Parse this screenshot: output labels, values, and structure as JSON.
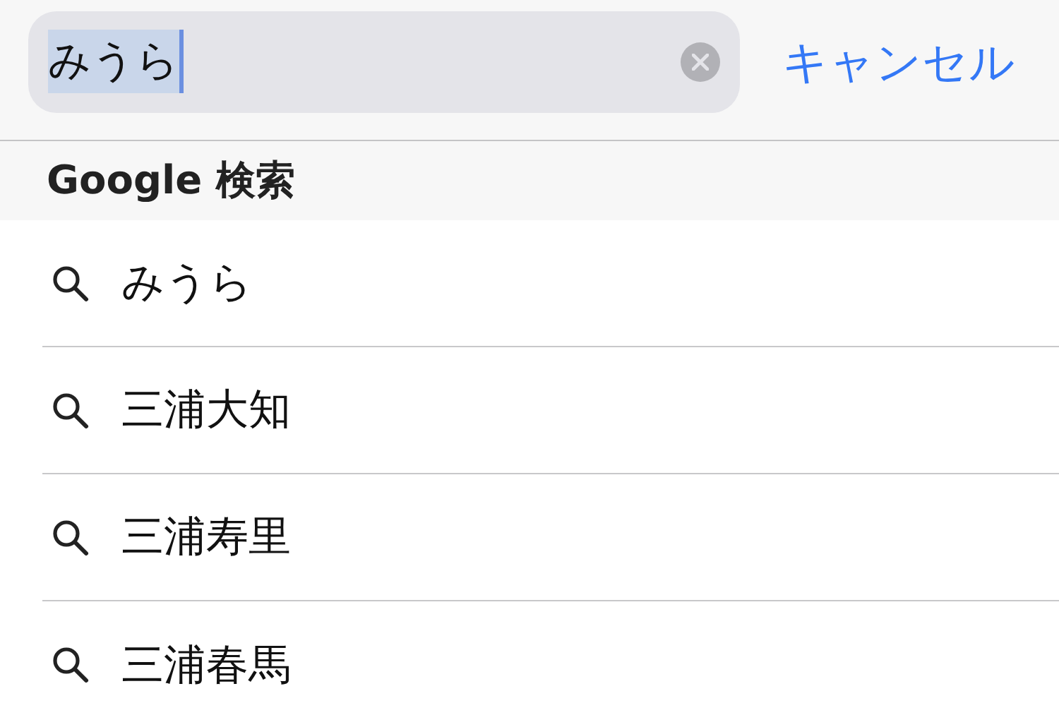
{
  "search": {
    "value": "みうら",
    "text_selected": true,
    "cancel": "キャンセル"
  },
  "section": {
    "title": "Google 検索"
  },
  "suggestions": [
    {
      "text": "みうら"
    },
    {
      "text": "三浦大知"
    },
    {
      "text": "三浦寿里"
    },
    {
      "text": "三浦春馬"
    }
  ]
}
